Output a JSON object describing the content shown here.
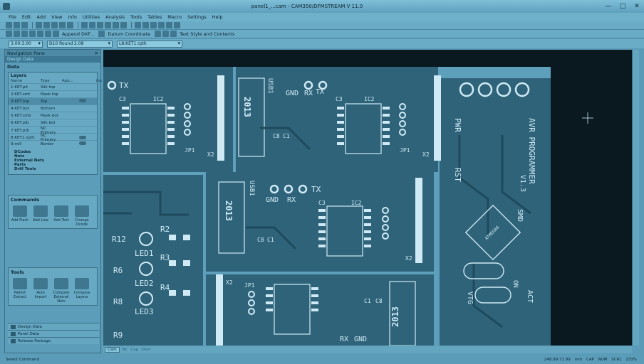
{
  "window": {
    "title": "panel1_...cam - CAM350/DFMSTREAM V 11.0",
    "minimize": "—",
    "maximize": "□",
    "close": "✕"
  },
  "menu": [
    "File",
    "Edit",
    "Add",
    "View",
    "Info",
    "Utilities",
    "Analysis",
    "Tools",
    "Tables",
    "Macro",
    "Settings",
    "Help"
  ],
  "toolbar2": {
    "append_dxf": "Append DXF...",
    "datum_coordinate": "Datum Coordinate",
    "text_style": "Text Style and Contents"
  },
  "combos": {
    "grid": "3.00:3.00",
    "dcode": "D10   Round 2.08",
    "layer": "L8:KET1.rpth"
  },
  "nav": {
    "title": "Navigation Pane",
    "close": "✕",
    "tab": "Design Data",
    "data_title": "Data",
    "layers_label": "Layers",
    "columns": [
      "Name",
      "Type",
      "App...",
      "ins"
    ],
    "layers": [
      {
        "name": "1:KET.plt",
        "type": "Silk top"
      },
      {
        "name": "2:KET.smt",
        "type": "Mask top"
      },
      {
        "name": "3:KET.top",
        "type": "Top"
      },
      {
        "name": "4:KET.bot",
        "type": "Bottom"
      },
      {
        "name": "5:KET.smb",
        "type": "Mask bot"
      },
      {
        "name": "6:KET.plb",
        "type": "Silk bot"
      },
      {
        "name": "7:KET.pth",
        "type": "NC Primary"
      },
      {
        "name": "8:KET1.npth",
        "type": "NC Primary"
      },
      {
        "name": "9:mill",
        "type": "Border"
      }
    ],
    "tree": [
      "DCodes",
      "Nets",
      "External Nets",
      "Parts",
      "Drill Tools"
    ],
    "commands_title": "Commands",
    "commands": [
      "Add Flash",
      "Add Line",
      "Add Text",
      "Change Dcode"
    ],
    "tools_title": "Tools",
    "tools": [
      "Netlist Extract",
      "Auto Import",
      "Compare External Nets",
      "Compare Layers"
    ],
    "bottom_tabs": [
      "Design Data",
      "Panel Data",
      "Release Package"
    ]
  },
  "canvas_tabs": [
    "Cam",
    "NC",
    "Cap",
    "Start"
  ],
  "status": {
    "left": "Select Command",
    "coords": "248.99:71.99",
    "unit": "mm",
    "cap": "CAP",
    "num": "NUM",
    "scrl": "SCRL",
    "zoom": "233%"
  },
  "pcb": {
    "labels": {
      "tx": "TX",
      "rx": "RX",
      "gnd": "GND",
      "usb1": "USB1",
      "year": "2013",
      "ic2": "IC2",
      "jp1": "JP1",
      "x2": "X2",
      "c3": "C3",
      "c1": "C1",
      "c8": "C8",
      "r12": "R12",
      "r6": "R6",
      "r8": "R8",
      "r9": "R9",
      "r2": "R2",
      "r3": "R3",
      "r4": "R4",
      "led1": "LED1",
      "led2": "LED2",
      "led3": "LED3",
      "pwr": "PWR",
      "rst": "RST",
      "avr": "AVR PROGRAMMER",
      "ver": "V1.3",
      "smd": "SMD",
      "act": "ACT",
      "on": "ON",
      "vtg": "VTG",
      "atmega": "ATMEGA8"
    }
  },
  "colors": {
    "ui_bg": "#5a9bb8",
    "canvas_bg": "#0a1820",
    "board": "#5e9fbb",
    "board_dark": "#2f6379",
    "copper": "#1e4a5d",
    "silk": "#cfeaf5"
  }
}
